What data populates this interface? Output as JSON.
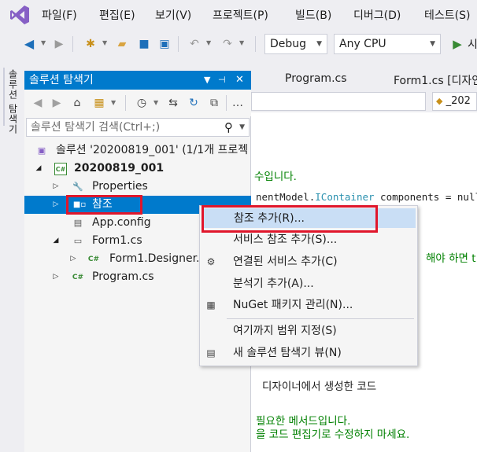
{
  "menu": {
    "items": [
      "파일(F)",
      "편집(E)",
      "보기(V)",
      "프로젝트(P)",
      "빌드(B)",
      "디버그(D)",
      "테스트(S)"
    ]
  },
  "toolbar": {
    "config": "Debug",
    "platform": "Any CPU",
    "run_label": "시"
  },
  "side_tab": {
    "label": "솔루션 탐색기"
  },
  "solution_explorer": {
    "title": "솔루션 탐색기",
    "search_placeholder": "솔루션 탐색기 검색(Ctrl+;)",
    "tree": {
      "solution": "솔루션 '20200819_001' (1/1개 프로젝",
      "project": "20200819_001",
      "properties": "Properties",
      "references": "참조",
      "appconfig": "App.config",
      "form1": "Form1.cs",
      "form1designer": "Form1.Designer.cs",
      "program": "Program.cs"
    },
    "project_badge": "C#",
    "cs_badge": "C#"
  },
  "editor": {
    "tabs": [
      "Program.cs",
      "Form1.cs [디자인"
    ],
    "nav_right": "_202",
    "lines": {
      "l1": "수입니다.",
      "l2a": "nentModel.",
      "l2b": "IContainer",
      "l2c": " components = null;",
      "l3": "해야 하면 t",
      "l4": "디자이너에서 생성한 코드",
      "l5": "필요한 메서드입니다.",
      "l6": "을 코드 편집기로 수정하지 마세요."
    }
  },
  "context_menu": {
    "items": [
      {
        "label": "참조 추가(R)..."
      },
      {
        "label": "서비스 참조 추가(S)..."
      },
      {
        "label": "연결된 서비스 추가(C)"
      },
      {
        "label": "분석기 추가(A)..."
      },
      {
        "label": "NuGet 패키지 관리(N)..."
      },
      {
        "label": "여기까지 범위 지정(S)"
      },
      {
        "label": "새 솔루션 탐색기 뷰(N)"
      }
    ]
  },
  "colors": {
    "accent": "#007acc",
    "highlight": "#c9def5",
    "annotation_red": "#e0162b"
  }
}
